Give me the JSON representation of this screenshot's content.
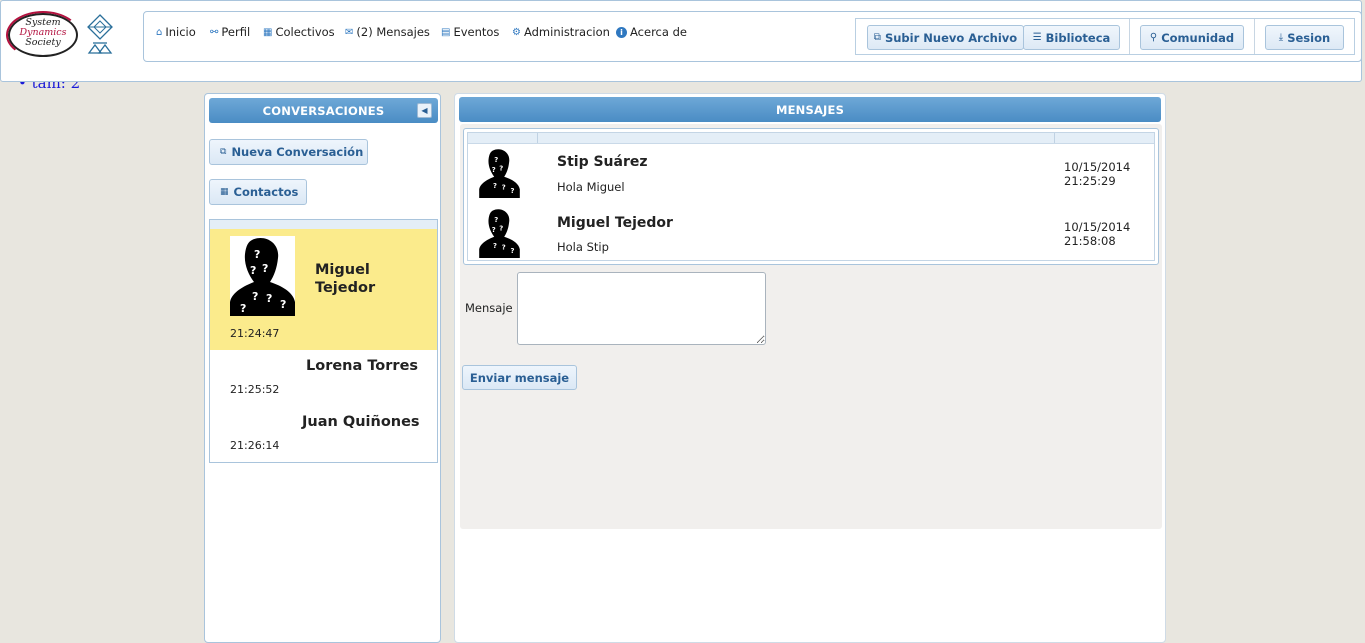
{
  "stray_text": "• tam: 2",
  "logo": {
    "line1": "System",
    "line2": "Dynamics",
    "line3": "Society"
  },
  "menu": [
    {
      "label": "Inicio",
      "icon": "home-icon"
    },
    {
      "label": "Perfil",
      "icon": "user-icon"
    },
    {
      "label": "Colectivos",
      "icon": "group-icon"
    },
    {
      "label": "(2) Mensajes",
      "icon": "mail-icon"
    },
    {
      "label": "Eventos",
      "icon": "calendar-icon"
    },
    {
      "label": "Administracion",
      "icon": "gear-icon"
    },
    {
      "label": "Acerca de",
      "icon": "info-icon"
    }
  ],
  "toolbar": {
    "upload": "Subir Nuevo Archivo",
    "library": "Biblioteca",
    "community": "Comunidad",
    "session": "Sesion"
  },
  "conversations": {
    "header": "CONVERSACIONES",
    "new_button": "Nueva Conversación",
    "contacts_button": "Contactos",
    "items": [
      {
        "name_line1": "Miguel",
        "name_line2": "Tejedor",
        "time": "21:24:47",
        "active": true
      },
      {
        "name": "Lorena Torres",
        "time": "21:25:52"
      },
      {
        "name": "Juan Quiñones",
        "time": "21:26:14"
      }
    ]
  },
  "messages": {
    "header": "MENSAJES",
    "items": [
      {
        "sender": "Stip Suárez",
        "text": "Hola Miguel",
        "date": "10/15/2014",
        "time": "21:25:29"
      },
      {
        "sender": "Miguel Tejedor",
        "text": "Hola Stip",
        "date": "10/15/2014",
        "time": "21:58:08"
      }
    ],
    "input_label": "Mensaje",
    "send_button": "Enviar mensaje"
  },
  "colors": {
    "accent": "#4a8cc4",
    "active_row": "#fbeb8c",
    "link_text": "#2a5f94"
  }
}
